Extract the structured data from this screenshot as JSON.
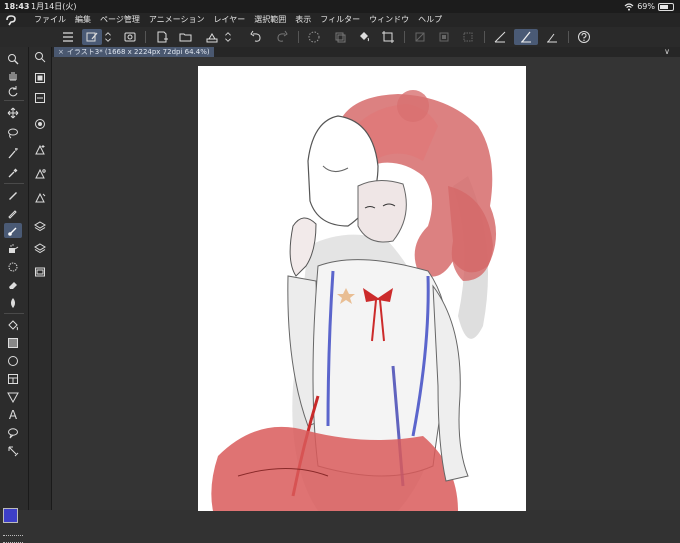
{
  "status": {
    "time": "18:43",
    "date": "1月14日(火)",
    "battery": "69%",
    "battery_level": 0.69
  },
  "menu": [
    "ファイル",
    "編集",
    "ページ管理",
    "アニメーション",
    "レイヤー",
    "選択範囲",
    "表示",
    "フィルター",
    "ウィンドウ",
    "ヘルプ"
  ],
  "document": {
    "tab_title": "イラスト3* (1668 x 2224px 72dpi 64.4%)",
    "close_glyph": "×",
    "menu_glyph": "∨"
  },
  "colors": {
    "main_color": "#3d3fc7",
    "active_highlight": "#4a5a75"
  },
  "tools": [
    "zoom-icon",
    "hand-icon",
    "rotate-icon",
    "move-icon",
    "lasso-icon",
    "eyedropper-icon",
    "pen-icon",
    "pencil-icon",
    "brush-icon",
    "airbrush-icon",
    "decoration-icon",
    "eraser-icon",
    "blend-icon",
    "fill-icon",
    "gradient-icon",
    "shape-icon",
    "frame-icon",
    "ruler-icon",
    "text-icon",
    "balloon-icon",
    "correction-icon"
  ],
  "icons": {
    "text_tool_glyph": "A"
  }
}
